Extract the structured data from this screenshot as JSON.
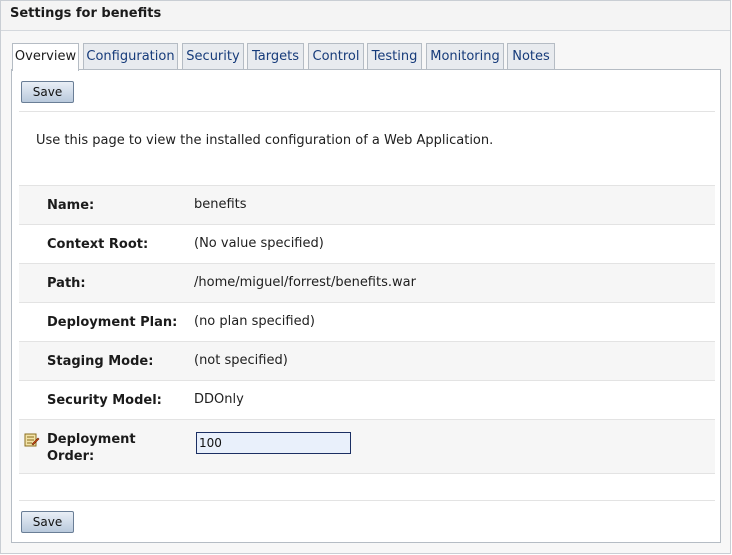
{
  "page": {
    "title": "Settings for benefits"
  },
  "tabs": [
    {
      "label": "Overview",
      "active": true
    },
    {
      "label": "Configuration",
      "active": false
    },
    {
      "label": "Security",
      "active": false
    },
    {
      "label": "Targets",
      "active": false
    },
    {
      "label": "Control",
      "active": false
    },
    {
      "label": "Testing",
      "active": false
    },
    {
      "label": "Monitoring",
      "active": false
    },
    {
      "label": "Notes",
      "active": false
    }
  ],
  "toolbar": {
    "save_label": "Save"
  },
  "intro": "Use this page to view the installed configuration of a Web Application.",
  "fields": [
    {
      "label": "Name:",
      "value": "benefits"
    },
    {
      "label": "Context Root:",
      "value": "(No value specified)"
    },
    {
      "label": "Path:",
      "value": "/home/miguel/forrest/benefits.war"
    },
    {
      "label": "Deployment Plan:",
      "value": "(no plan specified)"
    },
    {
      "label": "Staging Mode:",
      "value": "(not specified)"
    },
    {
      "label": "Security Model:",
      "value": "DDOnly"
    }
  ],
  "deployment_order": {
    "label_line1": "Deployment",
    "label_line2": "Order:",
    "value": "100",
    "icon": "edit-field-icon"
  },
  "colors": {
    "tab_link": "#163b7a",
    "input_border": "#1b2f63",
    "input_bg": "#e9f0fb"
  }
}
